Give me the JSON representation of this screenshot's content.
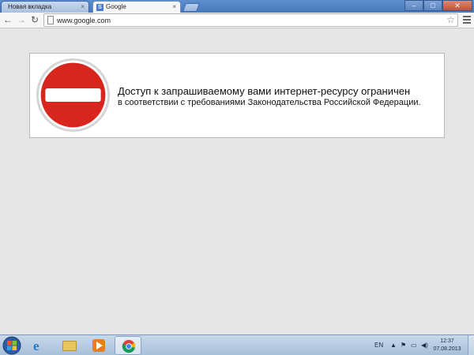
{
  "tabs": [
    {
      "title": "Новая вкладка",
      "active": false
    },
    {
      "title": "Google",
      "active": true
    }
  ],
  "tab_close_glyph": "×",
  "google_favicon_letter": "S",
  "window_controls": {
    "minimize": "–",
    "maximize": "□",
    "close": "✕"
  },
  "toolbar": {
    "back_glyph": "←",
    "forward_glyph": "→",
    "reload_glyph": "↻",
    "url": "www.google.com",
    "star_glyph": "☆"
  },
  "notice": {
    "title": "Доступ к запрашиваемому вами интернет-ресурсу ограничен",
    "text": "в соответствии  с требованиями Законодательства Российской Федерации."
  },
  "taskbar": {
    "ie_glyph": "e",
    "language": "EN",
    "tray_glyphs": [
      "▲",
      "⚑",
      "▭",
      "◀)"
    ],
    "time": "12:37",
    "date": "07.08.2013"
  },
  "colors": {
    "sign_red": "#d8261f",
    "sign_border": "#c7c7c7",
    "content_bg": "#e6e6e6",
    "tabstrip_blue": "#5d8fcf"
  },
  "icons": [
    "page-icon",
    "star-icon",
    "menu-icon",
    "no-entry-sign-icon",
    "windows-start-icon",
    "internet-explorer-icon",
    "folder-icon",
    "media-player-icon",
    "chrome-icon"
  ]
}
